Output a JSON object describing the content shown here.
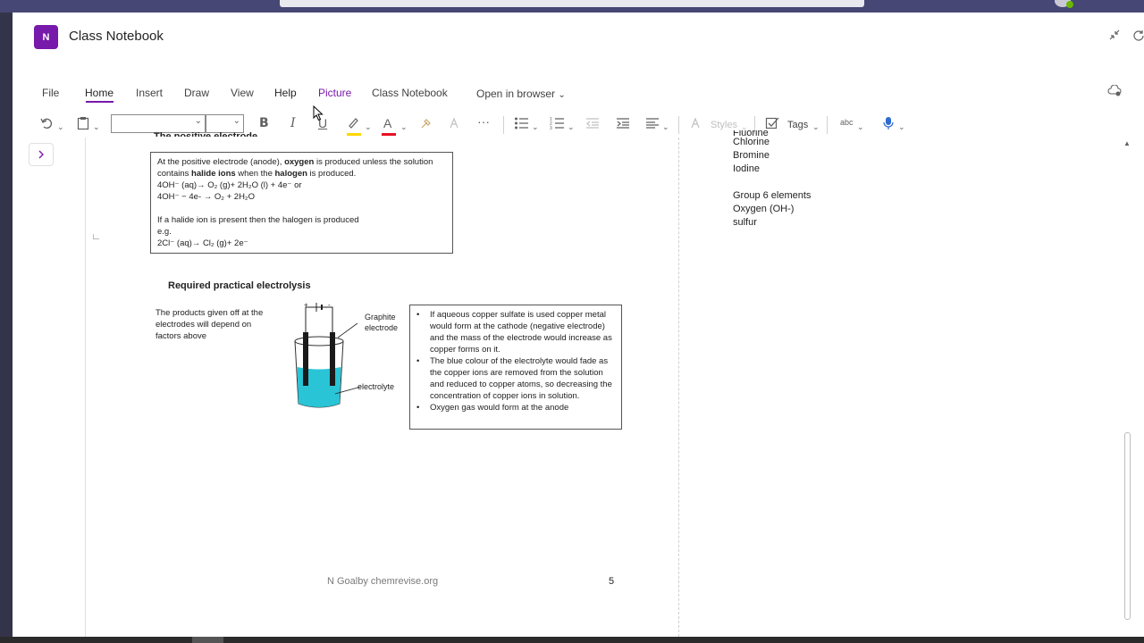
{
  "app": {
    "icon_label": "N",
    "title": "Class Notebook",
    "brand_color": "#7719aa"
  },
  "menu": {
    "file": "File",
    "home": "Home",
    "insert": "Insert",
    "draw": "Draw",
    "view": "View",
    "help": "Help",
    "picture": "Picture",
    "class_notebook": "Class Notebook",
    "open_in_browser": "Open in browser"
  },
  "toolbar": {
    "font_name": "",
    "font_size": "",
    "bold": "B",
    "italic": "I",
    "underline": "U",
    "font_color_letter": "A",
    "more": "···",
    "styles": "Styles",
    "tags": "Tags",
    "spell": "abc",
    "highlight_color": "#ffd700",
    "font_color": "#e81123"
  },
  "page": {
    "box1": {
      "line1_pre": "At the positive electrode (anode), ",
      "line1_bold": "oxygen",
      "line1_post": " is produced unless the solution",
      "line2_pre": "contains ",
      "line2_bold1": "halide ions",
      "line2_mid": " when the ",
      "line2_bold2": "halogen",
      "line2_post": " is produced.",
      "eq1": "4OH⁻ (aq)→ O₂ (g)+ 2H₂O (l) + 4e⁻   or",
      "eq2": "4OH⁻ − 4e- → O₂ + 2H₂O",
      "line5": "If a halide ion is present then the halogen is produced",
      "line6": "e.g.",
      "eq3": "2Cl⁻ (aq)→ Cl₂ (g)+ 2e⁻"
    },
    "required_title": "Required practical electrolysis",
    "products_text": "The products given off at the electrodes will depend on factors above",
    "diagram": {
      "plus": "+",
      "minus": "-",
      "label_graphite_1": "Graphite",
      "label_graphite_2": "electrode",
      "label_electrolyte": "electrolyte"
    },
    "bullets": [
      "If aqueous copper sulfate is used copper metal would form at the cathode (negative electrode) and the mass of the electrode would increase as copper forms on it.",
      "The blue colour of the electrolyte would fade as the copper ions are removed from the solution and reduced to copper atoms, so decreasing the concentration of copper ions in solution.",
      "Oxygen gas would form at the anode"
    ],
    "footer": "N Goalby chemrevise.org",
    "page_number": "5"
  },
  "notes": {
    "cut_line": "Fluorine",
    "items": [
      "Chlorine",
      "Bromine",
      "Iodine"
    ],
    "group6_title": "Group 6 elements",
    "group6_items": [
      "Oxygen (OH-)",
      "sulfur"
    ]
  }
}
